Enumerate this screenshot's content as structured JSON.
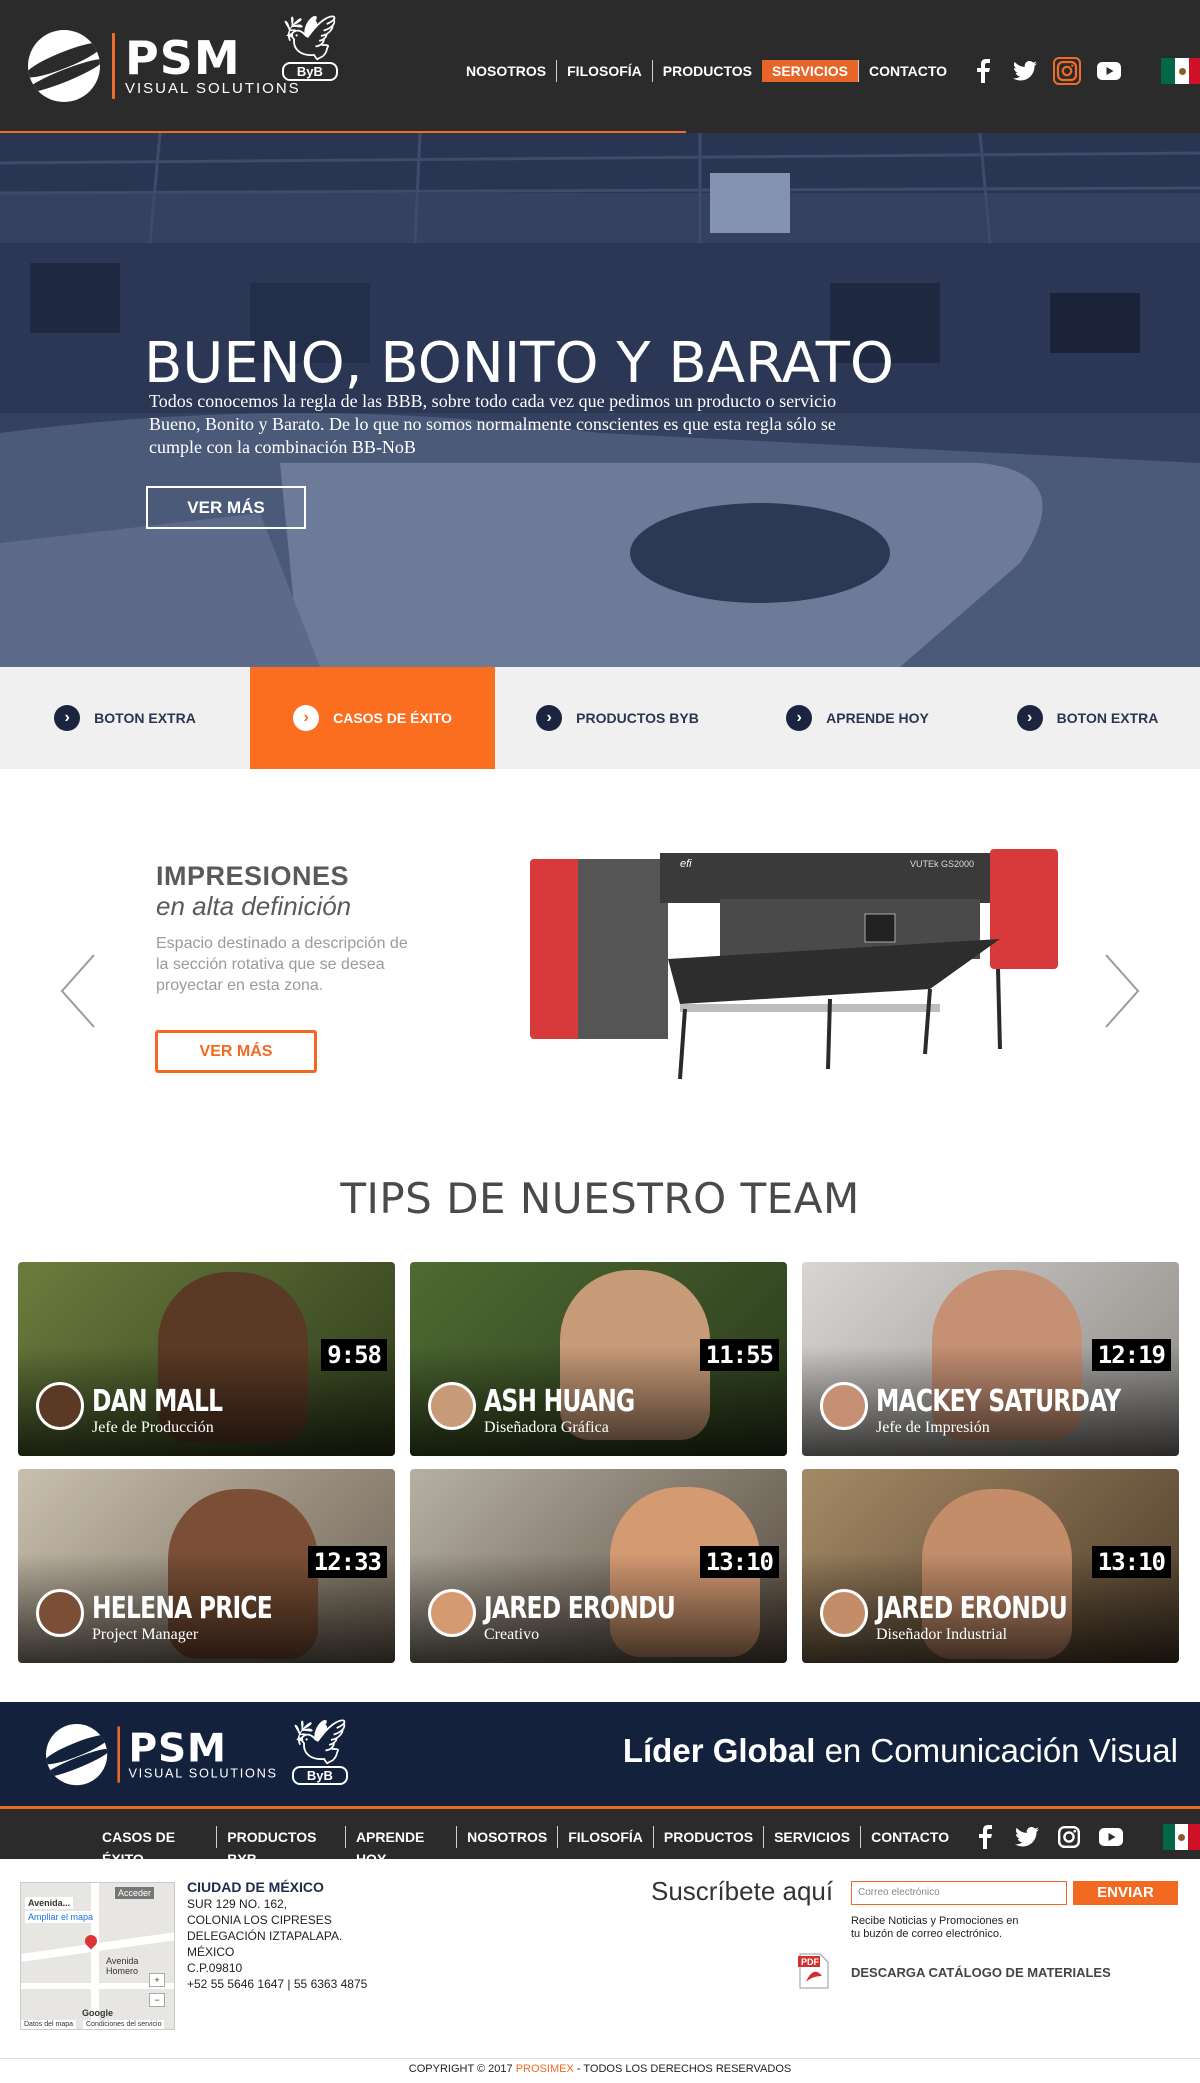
{
  "brand": {
    "name": "PSM",
    "subtitle": "VISUAL SOLUTIONS",
    "partner": "ByB",
    "accent": "#ef6c26",
    "dark": "#2b2b2b",
    "navy": "#14213d"
  },
  "nav": {
    "items": [
      {
        "label": "NOSOTROS",
        "active": false
      },
      {
        "label": "FILOSOFÍA",
        "active": false
      },
      {
        "label": "PRODUCTOS",
        "active": false
      },
      {
        "label": "SERVICIOS",
        "active": true
      },
      {
        "label": "CONTACTO",
        "active": false
      }
    ],
    "social": [
      "facebook-icon",
      "twitter-icon",
      "instagram-icon",
      "youtube-icon"
    ],
    "language_flag": "mexico-flag-icon"
  },
  "hero": {
    "title": "BUENO, BONITO Y BARATO",
    "text": "Todos conocemos la regla de las BBB, sobre todo cada vez que pedimos un producto o servicio Bueno, Bonito y Barato. De lo que no somos normalmente conscientes es que esta regla sólo se cumple con la combinación BB-NoB",
    "button": "VER MÁS"
  },
  "quick_links": [
    {
      "label": "BOTON EXTRA",
      "active": false
    },
    {
      "label": "CASOS DE ÉXITO",
      "active": true
    },
    {
      "label": "PRODUCTOS BYB",
      "active": false
    },
    {
      "label": "APRENDE HOY",
      "active": false
    },
    {
      "label": "BOTON EXTRA",
      "active": false
    }
  ],
  "slider": {
    "title": "IMPRESIONES",
    "subtitle": "en alta definición",
    "description": "Espacio destinado a descripción de la sección rotativa que se desea proyectar en esta zona.",
    "button": "VER MÁS",
    "printer_brand": "efi",
    "printer_model": "VUTEk GS2000"
  },
  "team": {
    "title": "TIPS DE NUESTRO TEAM",
    "members": [
      {
        "name": "DAN MALL",
        "role": "Jefe de Producción",
        "duration": "9:58"
      },
      {
        "name": "ASH HUANG",
        "role": "Diseñadora Gráfica",
        "duration": "11:55"
      },
      {
        "name": "MACKEY SATURDAY",
        "role": "Jefe de Impresión",
        "duration": "12:19"
      },
      {
        "name": "HELENA PRICE",
        "role": "Project Manager",
        "duration": "12:33"
      },
      {
        "name": "JARED ERONDU",
        "role": "Creativo",
        "duration": "13:10"
      },
      {
        "name": "JARED ERONDU",
        "role": "Diseñador Industrial",
        "duration": "13:10"
      }
    ]
  },
  "footer": {
    "tagline_bold": "Líder Global",
    "tagline_rest": "en Comunicación Visual",
    "nav": [
      "CASOS DE ÉXITO",
      "PRODUCTOS BYB",
      "APRENDE HOY",
      "NOSOTROS",
      "FILOSOFÍA",
      "PRODUCTOS",
      "SERVICIOS",
      "CONTACTO"
    ],
    "map": {
      "label1": "Avenida...",
      "label2": "Ampliar el mapa",
      "street": "Avenida Homero",
      "access": "Acceder",
      "google": "Google",
      "credits1": "Datos del mapa",
      "credits2": "Condiciones del servicio"
    },
    "address_title": "CIUDAD DE MÉXICO",
    "address_lines": [
      "SUR 129 NO. 162,",
      "COLONIA LOS CIPRESES",
      "DELEGACIÓN IZTAPALAPA.",
      "MÉXICO",
      "C.P.09810",
      "+52 55 5646 1647 | 55 6363 4875"
    ],
    "subscribe_title": "Suscríbete aquí",
    "email_placeholder": "Correo electrónico",
    "send_button": "ENVIAR",
    "subscribe_note": "Recibe Noticias y Promociones en tu buzón de correo electrónico.",
    "pdf_label": "PDF",
    "catalog": "DESCARGA CATÁLOGO DE MATERIALES",
    "copyright_pre": "COPYRIGHT © 2017",
    "copyright_brand": "PROSIMEX",
    "copyright_post": "- TODOS LOS DERECHOS RESERVADOS"
  }
}
